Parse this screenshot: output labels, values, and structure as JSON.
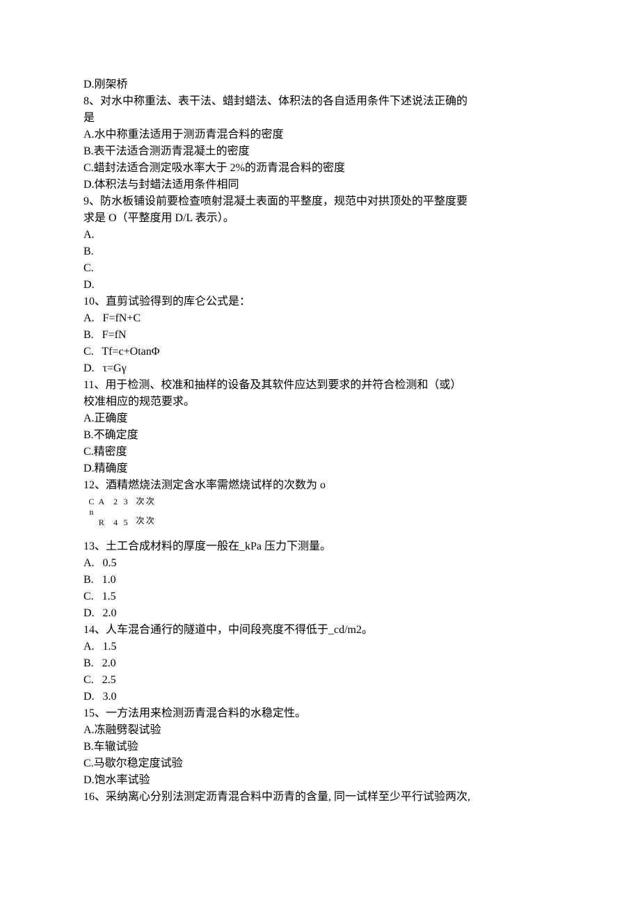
{
  "q7": {
    "optD": "D.刚架桥"
  },
  "q8": {
    "stem1": "8、对水中称重法、表干法、蜡封蜡法、体积法的各自适用条件下述说法正确的",
    "stem2": "是",
    "optA": "A.水中称重法适用于测沥青混合料的密度",
    "optB": "B.表干法适合测沥青混凝土的密度",
    "optC": "C.蜡封法适合测定吸水率大于 2%的沥青混合料的密度",
    "optD": "D.体积法与封蜡法适用条件相同"
  },
  "q9": {
    "stem1": "9、防水板铺设前要检查喷射混凝土表面的平整度，规范中对拱顶处的平整度要",
    "stem2": "求是 O（平整度用 D/L 表示）。",
    "optA": "A.",
    "optB": "B.",
    "optC": "C.",
    "optD": "D."
  },
  "q10": {
    "stem": "10、直剪试验得到的库仑公式是：",
    "optA": "A.   F=fN+C",
    "optB": "B.   F=fN",
    "optC": "C.   Tf=c+OtanΦ",
    "optD": "D.   τ=Gγ"
  },
  "q11": {
    "stem1": "11、用于检测、校准和抽样的设备及其软件应达到要求的并符合检测和（或）",
    "stem2": "校准相应的规范要求。",
    "optA": "A.正确度",
    "optB": "B.不确定度",
    "optC": "C.精密度",
    "optD": "D.精确度"
  },
  "q12": {
    "stem": "12、酒精燃烧法测定含水率需燃烧试样的次数为 o",
    "rot": {
      "col1": "A R Cn",
      "col2": "3 5 2 4",
      "col3": "次 次 次 次"
    }
  },
  "q13": {
    "stem": "13、土工合成材料的厚度一般在_kPa 压力下测量。",
    "optA": "A.   0.5",
    "optB": "B.   1.0",
    "optC": "C.   1.5",
    "optD": "D.   2.0"
  },
  "q14": {
    "stem": "14、人车混合通行的隧道中，中间段亮度不得低于_cd/m2。",
    "optA": "A.   1.5",
    "optB": "B.   2.0",
    "optC": "C.   2.5",
    "optD": "D.   3.0"
  },
  "q15": {
    "stem": "15、一方法用来检测沥青混合料的水稳定性。",
    "optA": "A.冻融劈裂试验",
    "optB": "B.车辙试验",
    "optC": "C.马歇尔稳定度试验",
    "optD": "D.饱水率试验"
  },
  "q16": {
    "stem": "16、采纳离心分别法测定沥青混合料中沥青的含量, 同一试样至少平行试验两次,"
  }
}
